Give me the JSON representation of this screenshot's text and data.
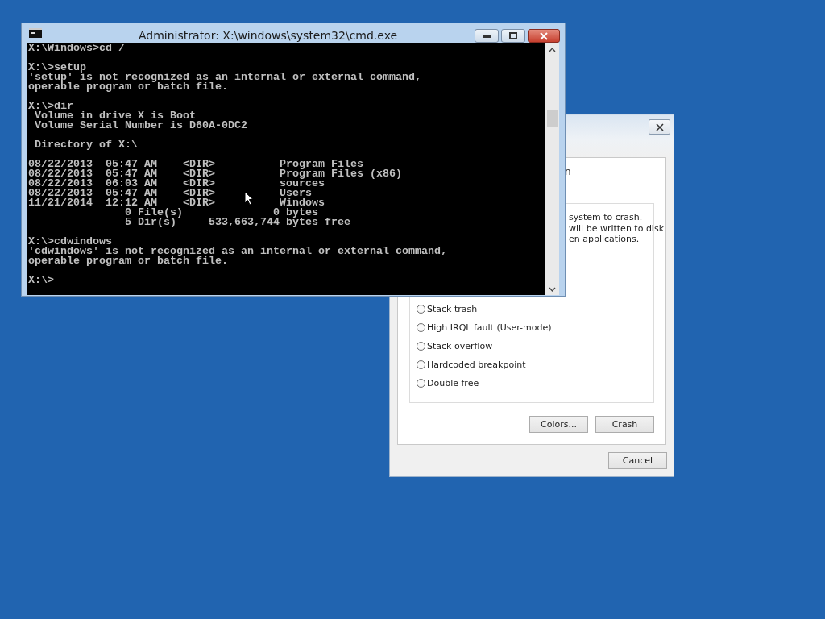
{
  "dialog": {
    "fragment_heading": "n",
    "fragment_lines": [
      "system to crash.",
      "will be written to disk",
      "en applications."
    ],
    "options": [
      {
        "label": "Stack trash",
        "selected": false
      },
      {
        "label": "High IRQL fault (User-mode)",
        "selected": false
      },
      {
        "label": "Stack overflow",
        "selected": false
      },
      {
        "label": "Hardcoded breakpoint",
        "selected": false
      },
      {
        "label": "Double free",
        "selected": false
      }
    ],
    "buttons": [
      "Colors...",
      "Crash"
    ],
    "cancel": "Cancel"
  },
  "cmd": {
    "title": "Administrator: X:\\windows\\system32\\cmd.exe",
    "blocks": [
      [
        "X:\\Windows>cd /"
      ],
      [
        "X:\\>setup",
        "'setup' is not recognized as an internal or external command,",
        "operable program or batch file."
      ],
      [
        "X:\\>dir",
        " Volume in drive X is Boot",
        " Volume Serial Number is D60A-0DC2"
      ],
      [
        " Directory of X:\\"
      ],
      [
        "08/22/2013  05:47 AM    <DIR>          Program Files",
        "08/22/2013  05:47 AM    <DIR>          Program Files (x86)",
        "08/22/2013  06:03 AM    <DIR>          sources",
        "08/22/2013  05:47 AM    <DIR>          Users",
        "11/21/2014  12:12 AM    <DIR>          Windows",
        "               0 File(s)              0 bytes",
        "               5 Dir(s)     533,663,744 bytes free"
      ],
      [
        "X:\\>cdwindows",
        "'cdwindows' is not recognized as an internal or external command,",
        "operable program or batch file."
      ],
      [
        "X:\\>"
      ]
    ]
  }
}
